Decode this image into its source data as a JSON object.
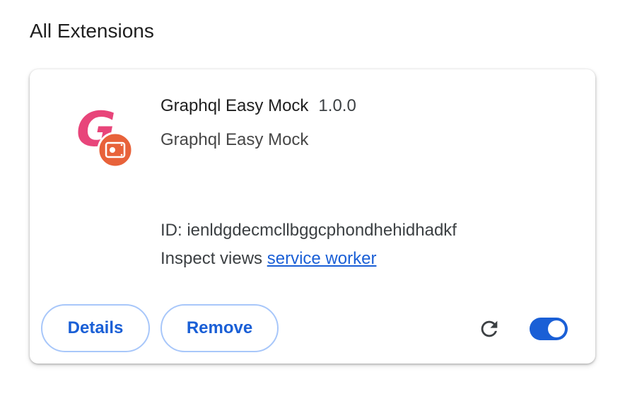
{
  "section": {
    "title": "All Extensions"
  },
  "extension": {
    "name": "Graphql Easy Mock",
    "version": "1.0.0",
    "description": "Graphql Easy Mock",
    "id_text": "ID: ienldgdecmcllbggcphondhehidhadkf",
    "inspect_label": "Inspect views",
    "inspect_link": "service worker",
    "icon_letter": "G",
    "icon": "graphql-easy-mock-logo-icon",
    "enabled": true
  },
  "actions": {
    "details_label": "Details",
    "remove_label": "Remove",
    "reload_icon": "reload-icon"
  },
  "colors": {
    "accent": "#1a5fd6",
    "button_border": "#a8c7fa",
    "logo_pink": "#e8457a",
    "logo_badge": "#e8623a"
  }
}
